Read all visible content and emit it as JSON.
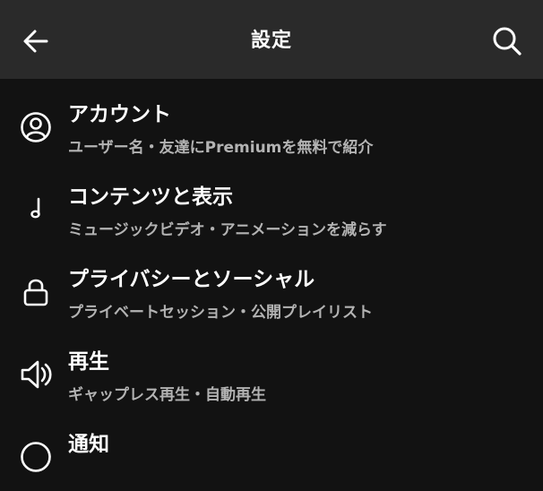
{
  "header": {
    "title": "設定",
    "back_icon": "arrow-left-icon",
    "search_icon": "search-icon"
  },
  "colors": {
    "background": "#121212",
    "header_background": "#2a2a2a",
    "text_primary": "#ffffff",
    "text_secondary": "#b3b3b3"
  },
  "settings": {
    "items": [
      {
        "label": "アカウント",
        "sub": "ユーザー名・友達にPremiumを無料で紹介",
        "icon": "user-circle-icon"
      },
      {
        "label": "コンテンツと表示",
        "sub": "ミュージックビデオ・アニメーションを減らす",
        "icon": "music-note-icon"
      },
      {
        "label": "プライバシーとソーシャル",
        "sub": "プライベートセッション・公開プレイリスト",
        "icon": "lock-icon"
      },
      {
        "label": "再生",
        "sub": "ギャップレス再生・自動再生",
        "icon": "speaker-icon"
      },
      {
        "label": "通知",
        "sub": "",
        "icon": "bell-icon"
      }
    ]
  }
}
